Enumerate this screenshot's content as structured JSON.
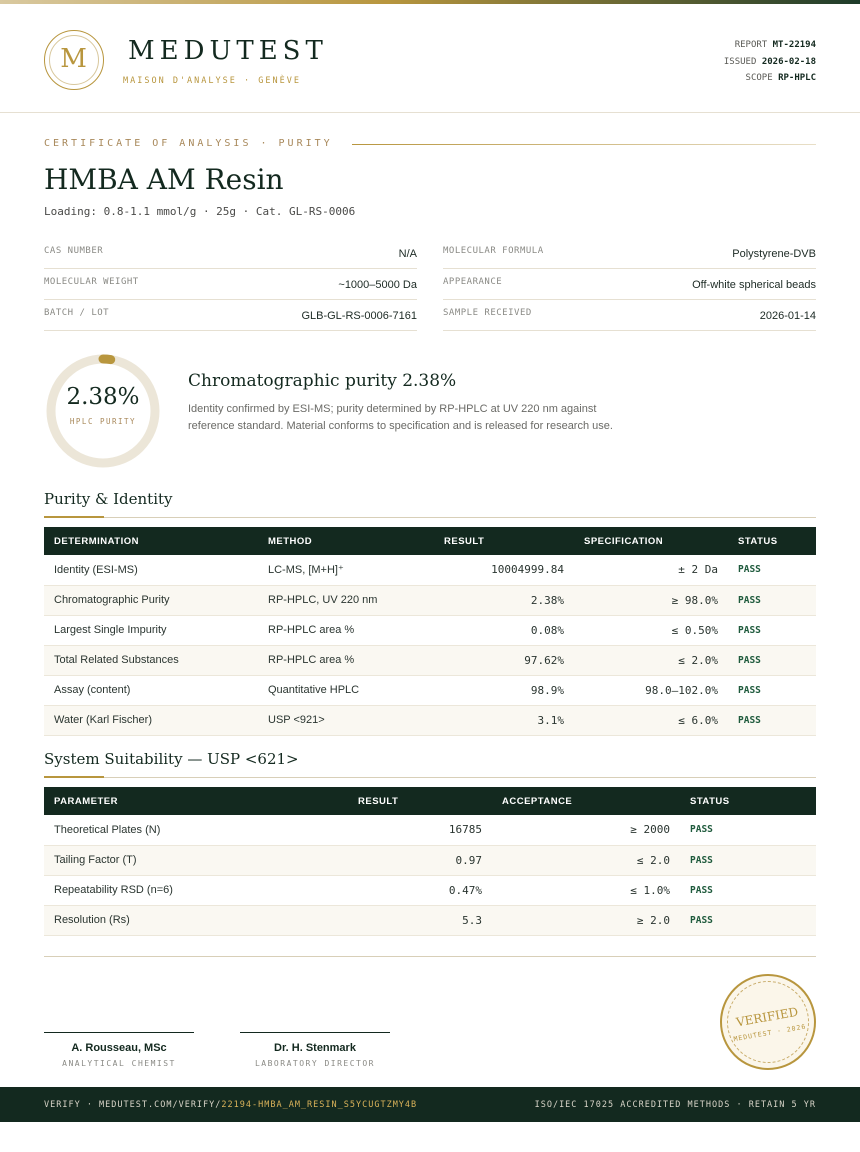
{
  "header": {
    "logo_letter": "M",
    "brand": "MEDUTEST",
    "tagline": "MAISON D'ANALYSE · GENÈVE",
    "report_label": "REPORT",
    "report_value": "MT-22194",
    "issued_label": "ISSUED",
    "issued_value": "2026-02-18",
    "scope_label": "SCOPE",
    "scope_value": "RP-HPLC"
  },
  "title": {
    "kicker": "CERTIFICATE OF ANALYSIS · PURITY",
    "product": "HMBA AM Resin",
    "loading": "Loading: 0.8-1.1 mmol/g · 25g  ·  Cat. GL-RS-0006"
  },
  "properties": [
    {
      "label": "CAS NUMBER",
      "value": "N/A"
    },
    {
      "label": "MOLECULAR FORMULA",
      "value": "Polystyrene-DVB"
    },
    {
      "label": "MOLECULAR WEIGHT",
      "value": "~1000–5000 Da"
    },
    {
      "label": "APPEARANCE",
      "value": "Off-white spherical beads"
    },
    {
      "label": "BATCH / LOT",
      "value": "GLB-GL-RS-0006-7161"
    },
    {
      "label": "SAMPLE RECEIVED",
      "value": "2026-01-14"
    }
  ],
  "purity": {
    "value_text": "2.38%",
    "fraction": 0.0238,
    "label": "HPLC PURITY",
    "summary_title": "Chromatographic purity 2.38%",
    "summary_text": "Identity confirmed by ESI-MS; purity determined by RP-HPLC at UV 220 nm against reference standard. Material conforms to specification and is released for research use."
  },
  "purity_table": {
    "title": "Purity & Identity",
    "headers": [
      "DETERMINATION",
      "METHOD",
      "RESULT",
      "SPECIFICATION",
      "STATUS"
    ],
    "rows": [
      [
        "Identity (ESI-MS)",
        "LC-MS, [M+H]⁺",
        "10004999.84",
        "± 2 Da",
        "PASS"
      ],
      [
        "Chromatographic Purity",
        "RP-HPLC, UV 220 nm",
        "2.38%",
        "≥ 98.0%",
        "PASS"
      ],
      [
        "Largest Single Impurity",
        "RP-HPLC area %",
        "0.08%",
        "≤ 0.50%",
        "PASS"
      ],
      [
        "Total Related Substances",
        "RP-HPLC area %",
        "97.62%",
        "≤ 2.0%",
        "PASS"
      ],
      [
        "Assay (content)",
        "Quantitative HPLC",
        "98.9%",
        "98.0–102.0%",
        "PASS"
      ],
      [
        "Water (Karl Fischer)",
        "USP <921>",
        "3.1%",
        "≤ 6.0%",
        "PASS"
      ]
    ]
  },
  "system_table": {
    "title": "System Suitability — USP <621>",
    "headers": [
      "PARAMETER",
      "RESULT",
      "ACCEPTANCE",
      "STATUS"
    ],
    "rows": [
      [
        "Theoretical Plates (N)",
        "16785",
        "≥ 2000",
        "PASS"
      ],
      [
        "Tailing Factor (T)",
        "0.97",
        "≤ 2.0",
        "PASS"
      ],
      [
        "Repeatability RSD (n=6)",
        "0.47%",
        "≤ 1.0%",
        "PASS"
      ],
      [
        "Resolution (Rs)",
        "5.3",
        "≥ 2.0",
        "PASS"
      ]
    ]
  },
  "signatures": [
    {
      "name": "A. Rousseau, MSc",
      "role": "ANALYTICAL CHEMIST"
    },
    {
      "name": "Dr. H. Stenmark",
      "role": "LABORATORY DIRECTOR"
    }
  ],
  "stamp": {
    "main": "VERIFIED",
    "sub": "MEDUTEST · 2026"
  },
  "footer": {
    "verify_prefix": "VERIFY · MEDUTEST.COM/VERIFY/",
    "verify_code": "22194-HMBA_AM_RESIN_S5YCUGTZMY4B",
    "right": "ISO/IEC 17025 ACCREDITED METHODS · RETAIN 5 YR"
  },
  "colors": {
    "primary": "#13291f",
    "gold": "#b8963e",
    "pass": "#1e5a3c"
  }
}
